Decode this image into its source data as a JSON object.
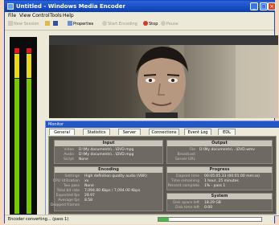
{
  "window": {
    "title": "Untitled - Windows Media Encoder"
  },
  "menu": [
    "File",
    "View",
    "Control",
    "Tools",
    "Help"
  ],
  "toolbar": {
    "new_session": "New Session",
    "properties": "Properties",
    "start_encoding": "Start Encoding",
    "stop": "Stop",
    "pause": "Pause"
  },
  "monitor": {
    "title": "Monitor",
    "tabs": [
      "General",
      "Statistics",
      "Server",
      "Connections",
      "Event Log",
      "EDL"
    ],
    "input": {
      "heading": "Input",
      "labels": [
        "Video",
        "Audio",
        "Script"
      ],
      "values": [
        "D:\\My documents\\...\\DVD.mpg",
        "D:\\My documents\\...\\DVD.mpg",
        "None"
      ]
    },
    "output": {
      "heading": "Output",
      "labels": [
        "File",
        "Broadcast",
        "Server URL"
      ],
      "values": [
        "D:\\My documents\\...\\DVD.wmv",
        "",
        ""
      ]
    },
    "encoding": {
      "heading": "Encoding",
      "labels": [
        "Settings",
        "CPU Utilization",
        "Two pass",
        "Total bit rate",
        "Expected fps",
        "Average fps",
        "Dropped frames"
      ],
      "values": [
        "High definition quality audio (VBR)",
        "xx",
        "None",
        "7,094.00 Kbps / 7,094.00 Kbps",
        "29.97",
        "8.58",
        ""
      ]
    },
    "progress": {
      "heading": "Progress",
      "labels": [
        "Elapsed time",
        "Time remaining",
        "Percent complete"
      ],
      "values": [
        "00:05:05.33 (00:01:00 mm:ss)",
        "1 hour, 25 minutes",
        "1% - pass 1"
      ]
    },
    "system": {
      "heading": "System",
      "labels": [
        "Disk space left",
        "Disk time left"
      ],
      "values": [
        "18.29 GB",
        "0:00"
      ]
    }
  },
  "status": {
    "text": "Encoder converting... (pass 1)",
    "progress_fraction": 0.1
  },
  "meters": {
    "left_level": 0.95,
    "right_level": 0.95
  },
  "colors": {
    "accent": "#0b3fb0",
    "panel": "#5a5650",
    "meter_green": "#78c800"
  }
}
